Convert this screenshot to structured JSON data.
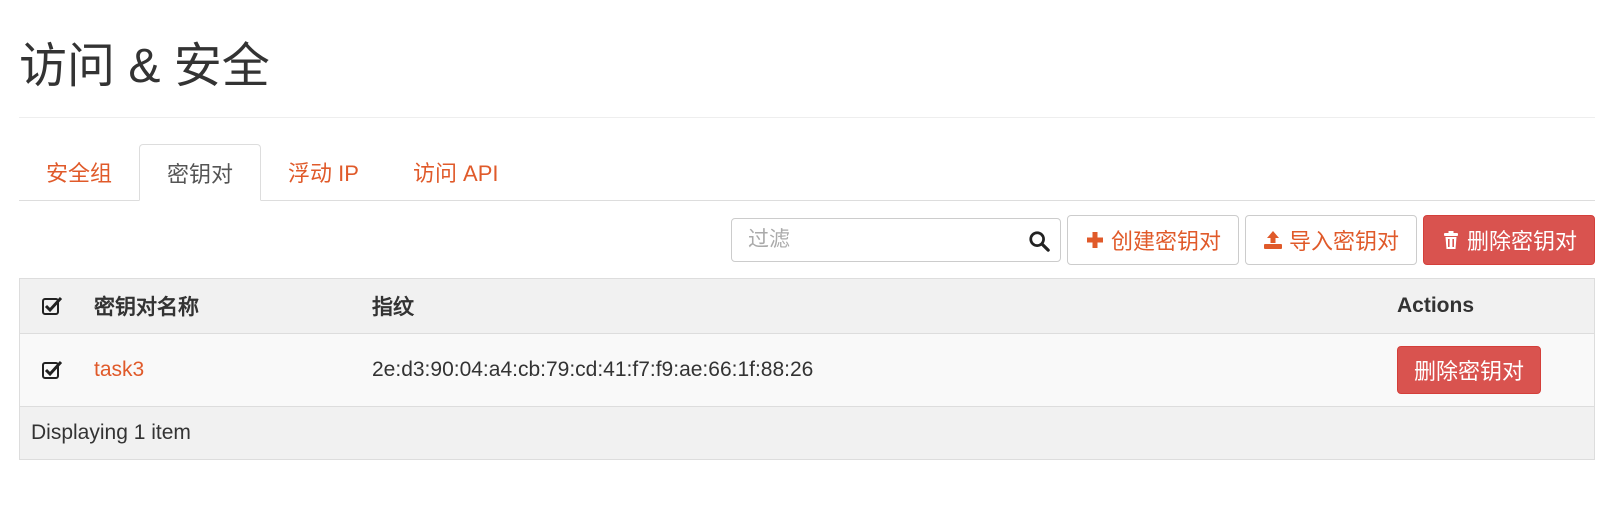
{
  "page": {
    "title": "访问 & 安全"
  },
  "tabs": [
    {
      "label": "安全组",
      "active": false
    },
    {
      "label": "密钥对",
      "active": true
    },
    {
      "label": "浮动 IP",
      "active": false
    },
    {
      "label": "访问 API",
      "active": false
    }
  ],
  "toolbar": {
    "filter_placeholder": "过滤",
    "create_label": "创建密钥对",
    "import_label": "导入密钥对",
    "delete_label": "删除密钥对"
  },
  "table": {
    "headers": {
      "name": "密钥对名称",
      "fingerprint": "指纹",
      "actions": "Actions"
    },
    "rows": [
      {
        "name": "task3",
        "fingerprint": "2e:d3:90:04:a4:cb:79:cd:41:f7:f9:ae:66:1f:88:26",
        "action_label": "删除密钥对",
        "checked": true
      }
    ],
    "footer": "Displaying 1 item"
  },
  "colors": {
    "accent": "#e05a2a",
    "danger": "#d9534f",
    "header_bg": "#f1f1f1"
  },
  "icons": {
    "search": "search-icon",
    "create": "plus-icon",
    "import": "upload-icon",
    "delete": "trash-icon",
    "checkbox": "checkbox-checked-icon"
  }
}
